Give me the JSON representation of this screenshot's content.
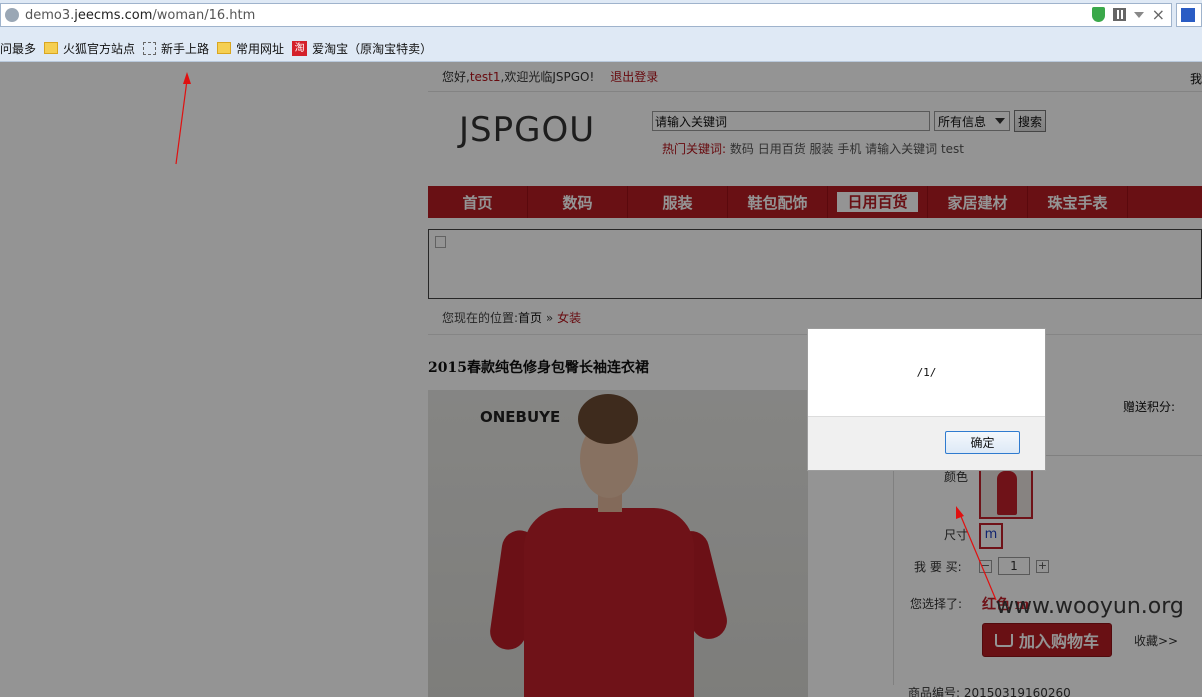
{
  "browser": {
    "url_prefix": "demo3.",
    "url_host": "jeecms.com",
    "url_path": "/woman/16.htm",
    "bookmarks": [
      {
        "icon": "folder",
        "label": "访问最多"
      },
      {
        "icon": "folder",
        "label": "火狐官方站点"
      },
      {
        "icon": "page",
        "label": "新手上路"
      },
      {
        "icon": "folder",
        "label": "常用网址"
      },
      {
        "icon": "taobao",
        "label": "爱淘宝（原淘宝特卖）"
      }
    ],
    "taobao_glyph": "淘"
  },
  "topbar": {
    "greeting_prefix": "您好,",
    "username": "test1",
    "greeting_suffix": ",欢迎光临JSPGO!",
    "logout": "退出登录",
    "right_text": "我"
  },
  "header": {
    "logo": "JSPGOU",
    "search_value": "请输入关键词",
    "search_scope": "所有信息",
    "search_button": "搜索",
    "hot_label": "热门关键词:",
    "hot_keywords": "数码 日用百货 服装 手机 请输入关键词 test"
  },
  "nav": {
    "items": [
      "首页",
      "数码",
      "服装",
      "鞋包配饰",
      "日用百货",
      "家居建材",
      "珠宝手表"
    ],
    "active_index": 4
  },
  "breadcrumb": {
    "prefix": "您现在的位置:",
    "home": "首页",
    "separator": "»",
    "current": "女装"
  },
  "product": {
    "title": "2015春款纯色修身包臀长袖连衣裙",
    "brand_text": "ONEBUYE",
    "score_label": "赠送积分:",
    "color_label": "颜色",
    "size_label": "尺寸",
    "size_value": "m",
    "buy_label": "我 要 买:",
    "quantity": "1",
    "minus": "−",
    "plus": "+",
    "chosen_label": "您选择了:",
    "chosen_value": "红色 m",
    "add_to_cart": "加入购物车",
    "favorite": "收藏>>",
    "product_no_label": "商品编号:",
    "product_no": "20150319160260"
  },
  "dialog": {
    "message": "/1/",
    "ok_button": "确定"
  },
  "watermark": "www.wooyun.org",
  "colors": {
    "brand_red": "#b51d23",
    "overlay": "rgba(0,0,0,0.42)"
  }
}
